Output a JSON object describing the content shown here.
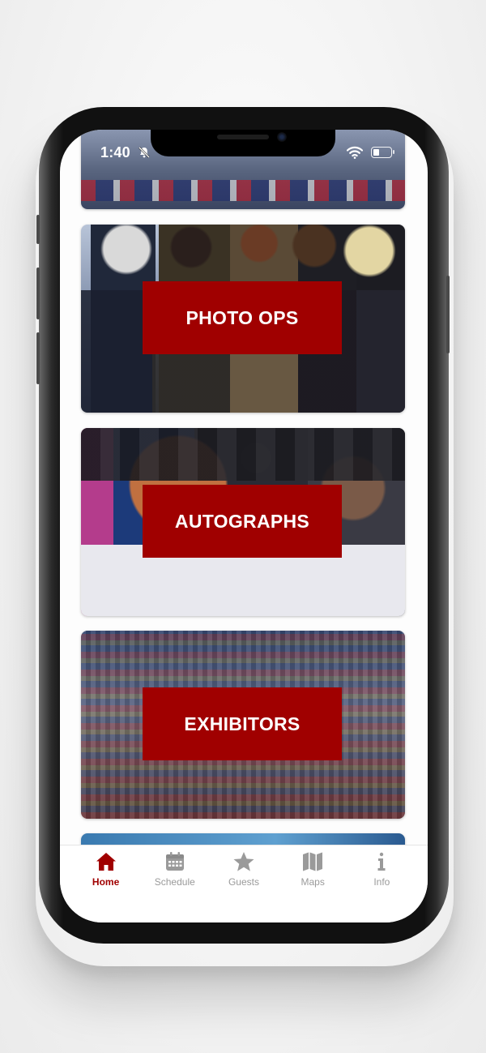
{
  "status_bar": {
    "time": "1:40"
  },
  "cards": [
    {
      "name": "previous-card",
      "label": ""
    },
    {
      "name": "photo-ops-card",
      "label": "PHOTO OPS"
    },
    {
      "name": "autographs-card",
      "label": "AUTOGRAPHS"
    },
    {
      "name": "exhibitors-card",
      "label": "EXHIBITORS"
    }
  ],
  "tabs": [
    {
      "label": "Home",
      "icon": "home-icon",
      "active": true
    },
    {
      "label": "Schedule",
      "icon": "calendar-icon",
      "active": false
    },
    {
      "label": "Guests",
      "icon": "star-icon",
      "active": false
    },
    {
      "label": "Maps",
      "icon": "map-icon",
      "active": false
    },
    {
      "label": "Info",
      "icon": "info-icon",
      "active": false
    }
  ],
  "colors": {
    "accent": "#a00000",
    "tab_inactive": "#9a9a9a",
    "label_bg": "#a00000"
  }
}
